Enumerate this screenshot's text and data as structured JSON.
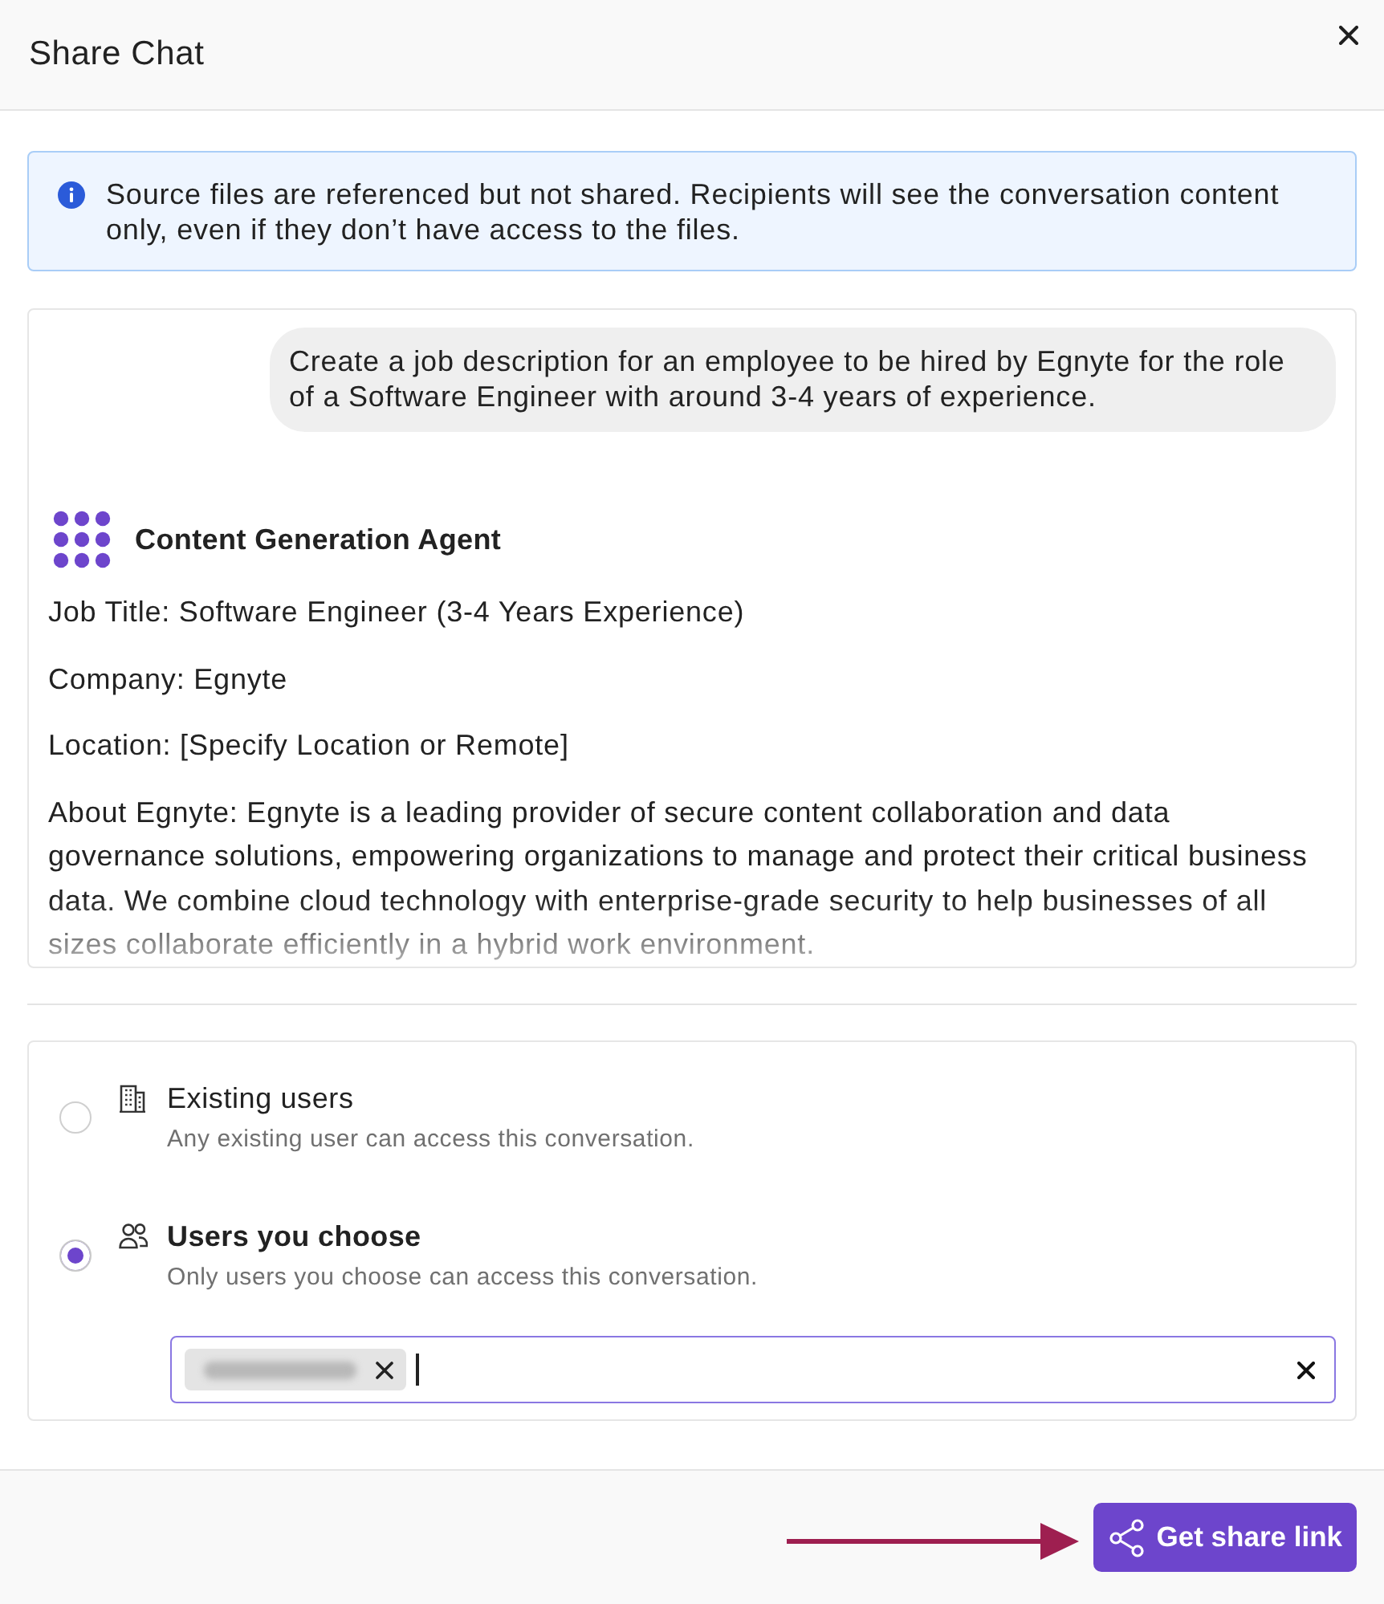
{
  "dialog": {
    "title": "Share Chat"
  },
  "notice": {
    "text": "Source files are referenced but not shared. Recipients will see the conversation content only, even if they don’t have access to the files."
  },
  "conversation": {
    "user_message": "Create a job description for an employee to be hired by Egnyte for the role of a Software Engineer with around 3-4 years of experience.",
    "agent_name": "Content Generation Agent",
    "agent_paragraphs": [
      "Job Title: Software Engineer (3-4 Years Experience)",
      "Company: Egnyte",
      "Location: [Specify Location or Remote]",
      "About Egnyte: Egnyte is a leading provider of secure content collaboration and data governance solutions, empowering organizations to manage and protect their critical business data. We combine cloud technology with enterprise-grade security to help businesses of all sizes collaborate efficiently in a hybrid work environment."
    ]
  },
  "access_options": [
    {
      "kind": "existing",
      "label": "Existing users",
      "description": "Any existing user can access this conversation.",
      "selected": false
    },
    {
      "kind": "chosen",
      "label": "Users you choose",
      "description": "Only users you choose can access this conversation.",
      "selected": true,
      "recipients": [
        {
          "name_blurred": true
        }
      ]
    }
  ],
  "share_button": {
    "label": "Get share link"
  },
  "annotations": [
    {
      "kind": "arrow"
    }
  ]
}
